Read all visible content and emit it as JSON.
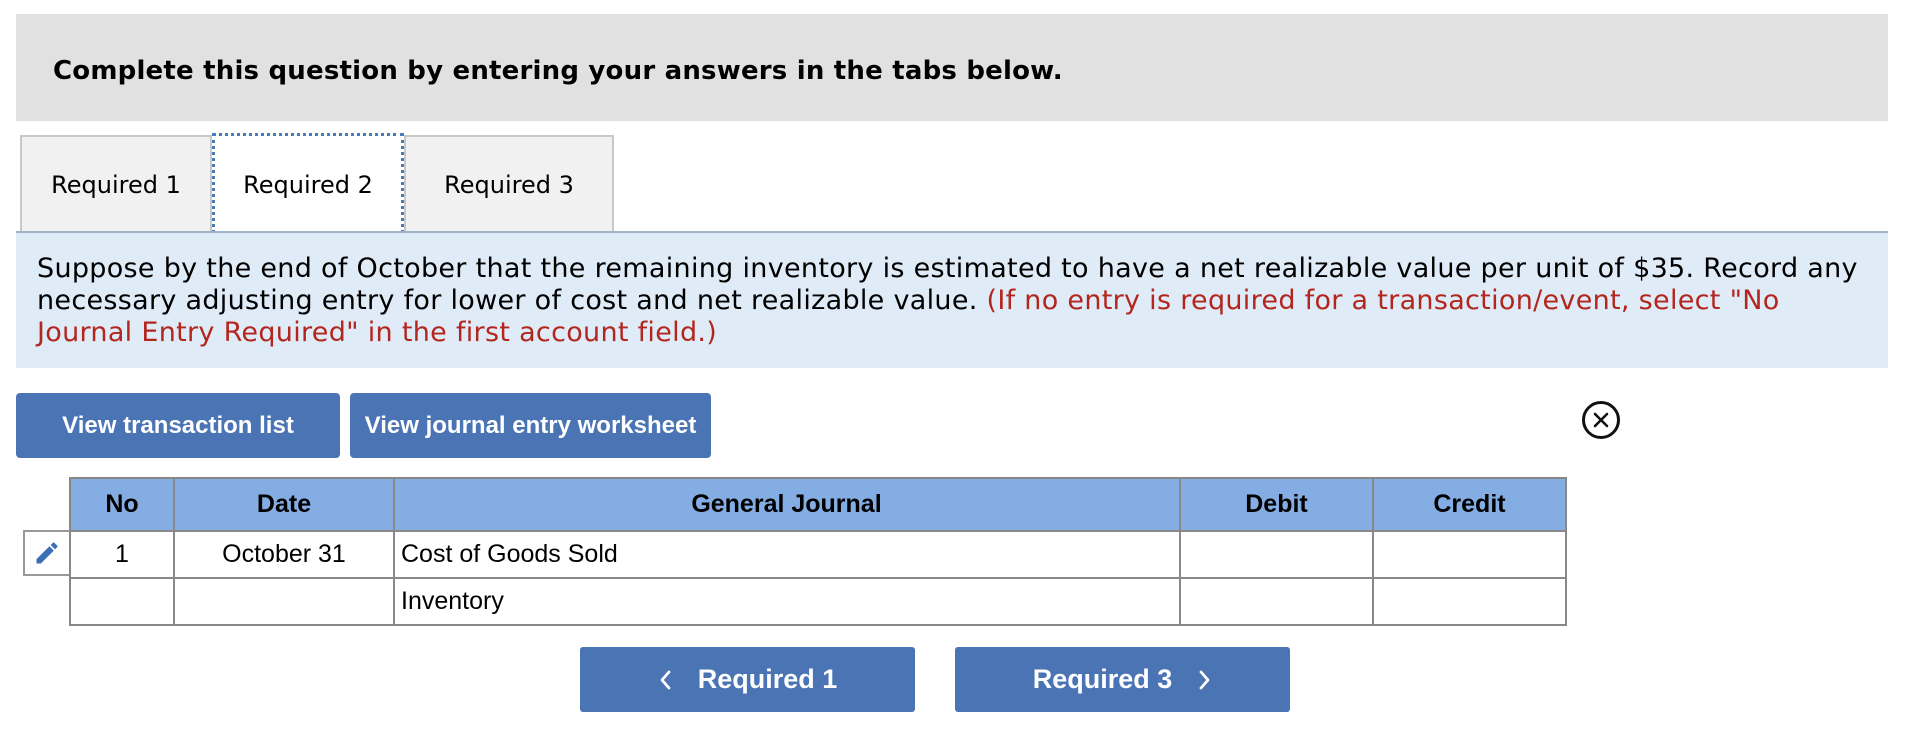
{
  "header": {
    "title": "Complete this question by entering your answers in the tabs below."
  },
  "tabs": [
    {
      "label": "Required 1"
    },
    {
      "label": "Required 2"
    },
    {
      "label": "Required 3"
    }
  ],
  "active_tab": "Required 2",
  "question": {
    "text": "Suppose by the end of October that the remaining inventory is estimated to have a net realizable value per unit of $35. Record any necessary adjusting entry for lower of cost and net realizable value.",
    "instruction": "(If no entry is required for a transaction/event, select \"No Journal Entry Required\" in the first account field.)"
  },
  "buttons": {
    "view_transaction_list": "View transaction list",
    "view_journal_entry_worksheet": "View journal entry worksheet"
  },
  "table": {
    "headers": {
      "no": "No",
      "date": "Date",
      "general_journal": "General Journal",
      "debit": "Debit",
      "credit": "Credit"
    },
    "rows": [
      {
        "no": "1",
        "date": "October 31",
        "account": "Cost of Goods Sold",
        "debit": "",
        "credit": ""
      },
      {
        "no": "",
        "date": "",
        "account": "Inventory",
        "debit": "",
        "credit": ""
      }
    ]
  },
  "nav": {
    "prev_label": "Required 1",
    "next_label": "Required 3"
  },
  "colors": {
    "accent": "#4a74b3",
    "header_row": "#84aee3",
    "question_bg": "#dfebf7",
    "instruction_red": "#b3261e"
  },
  "icons": {
    "close": "close-circle-icon",
    "edit": "pencil-icon",
    "prev": "chevron-left-icon",
    "next": "chevron-right-icon"
  }
}
